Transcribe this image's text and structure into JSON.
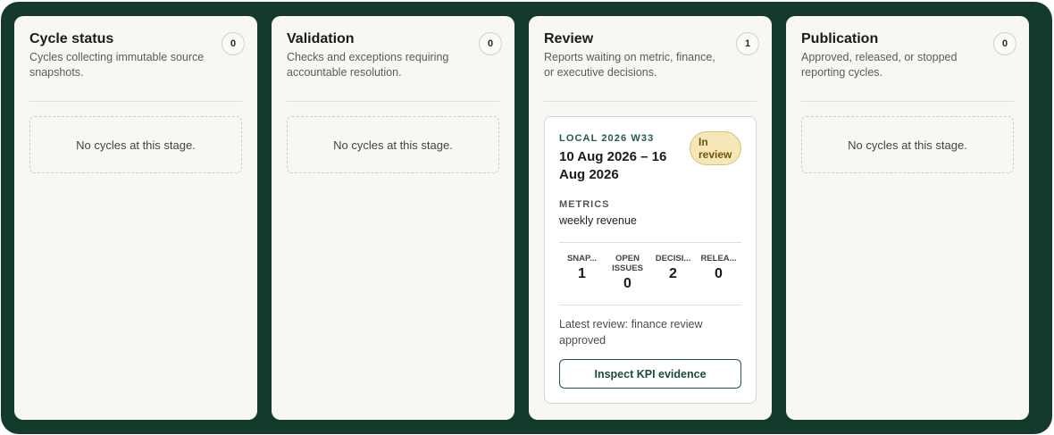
{
  "columns": [
    {
      "title": "Cycle status",
      "description": "Cycles collecting immutable source snapshots.",
      "count": "0",
      "empty_text": "No cycles at this stage."
    },
    {
      "title": "Validation",
      "description": "Checks and exceptions requiring accountable resolution.",
      "count": "0",
      "empty_text": "No cycles at this stage."
    },
    {
      "title": "Review",
      "description": "Reports waiting on metric, finance, or executive decisions.",
      "count": "1",
      "card": {
        "eyebrow": "LOCAL 2026 W33",
        "period": "10 Aug 2026 – 16 Aug 2026",
        "badge": "In review",
        "metrics_label": "METRICS",
        "metrics_value": "weekly revenue",
        "stats": [
          {
            "label": "SNAP...",
            "value": "1"
          },
          {
            "label": "OPEN ISSUES",
            "value": "0"
          },
          {
            "label": "DECISI...",
            "value": "2"
          },
          {
            "label": "RELEA...",
            "value": "0"
          }
        ],
        "latest": "Latest review: finance review approved",
        "action_label": "Inspect KPI evidence"
      }
    },
    {
      "title": "Publication",
      "description": "Approved, released, or stopped reporting cycles.",
      "count": "0",
      "empty_text": "No cycles at this stage."
    }
  ],
  "colors": {
    "board_background": "#133a2b",
    "column_background": "#f9f7f3",
    "accent": "#1f5b43",
    "badge_background": "#f5e7b6"
  }
}
